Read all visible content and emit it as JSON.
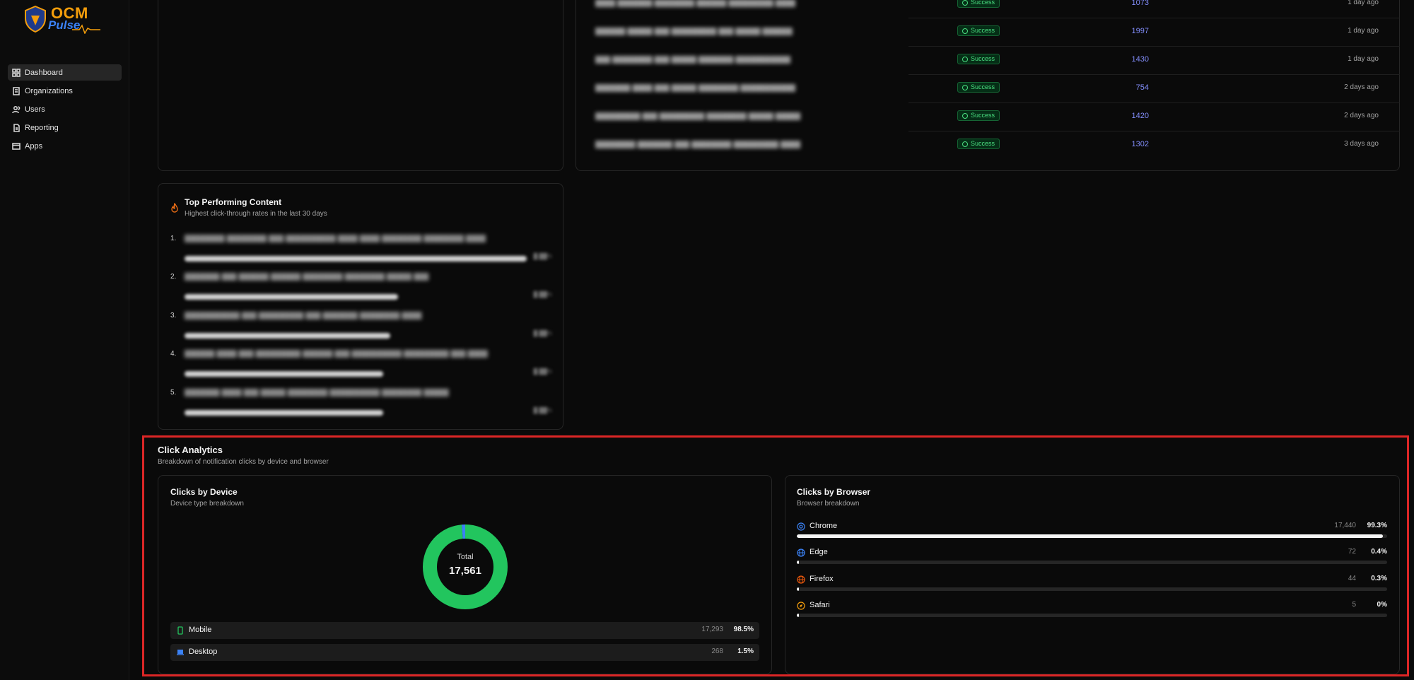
{
  "sidebar": {
    "logo": {
      "line1": "OCM",
      "line2": "Pulse"
    },
    "items": [
      {
        "label": "Dashboard",
        "icon": "grid-icon",
        "active": true
      },
      {
        "label": "Organizations",
        "icon": "building-icon",
        "active": false
      },
      {
        "label": "Users",
        "icon": "users-icon",
        "active": false
      },
      {
        "label": "Reporting",
        "icon": "file-icon",
        "active": false
      },
      {
        "label": "Apps",
        "icon": "window-icon",
        "active": false
      }
    ]
  },
  "recent": {
    "rows": [
      {
        "status": "Success",
        "count": "1073",
        "time": "1 day ago"
      },
      {
        "status": "Success",
        "count": "1997",
        "time": "1 day ago"
      },
      {
        "status": "Success",
        "count": "1430",
        "time": "1 day ago"
      },
      {
        "status": "Success",
        "count": "754",
        "time": "2 days ago"
      },
      {
        "status": "Success",
        "count": "1420",
        "time": "2 days ago"
      },
      {
        "status": "Success",
        "count": "1302",
        "time": "3 days ago"
      }
    ]
  },
  "top_content": {
    "title": "Top Performing Content",
    "subtitle": "Highest click-through rates in the last 30 days",
    "items": [
      {
        "rank": "1.",
        "fill": 0.93
      },
      {
        "rank": "2.",
        "fill": 0.58
      },
      {
        "rank": "3.",
        "fill": 0.56
      },
      {
        "rank": "4.",
        "fill": 0.54
      },
      {
        "rank": "5.",
        "fill": 0.54
      }
    ]
  },
  "click_analytics": {
    "title": "Click Analytics",
    "subtitle": "Breakdown of notification clicks by device and browser",
    "device": {
      "title": "Clicks by Device",
      "subtitle": "Device type breakdown",
      "total_label": "Total",
      "total": "17,561",
      "rows": [
        {
          "name": "Mobile",
          "count": "17,293",
          "pct": "98.5%",
          "icon": "phone-icon",
          "color": "#22c55e"
        },
        {
          "name": "Desktop",
          "count": "268",
          "pct": "1.5%",
          "icon": "laptop-icon",
          "color": "#3b82f6"
        }
      ]
    },
    "browser": {
      "title": "Clicks by Browser",
      "subtitle": "Browser breakdown",
      "rows": [
        {
          "name": "Chrome",
          "count": "17,440",
          "pct": "99.3%",
          "fill": 0.993,
          "icon": "chrome-icon",
          "color": "#3b82f6"
        },
        {
          "name": "Edge",
          "count": "72",
          "pct": "0.4%",
          "fill": 0.004,
          "icon": "globe-icon",
          "color": "#3b82f6"
        },
        {
          "name": "Firefox",
          "count": "44",
          "pct": "0.3%",
          "fill": 0.003,
          "icon": "globe-icon",
          "color": "#ea580c"
        },
        {
          "name": "Safari",
          "count": "5",
          "pct": "0%",
          "fill": 0.0,
          "icon": "compass-icon",
          "color": "#f59e0b"
        }
      ]
    }
  },
  "chart_data": {
    "type": "pie",
    "categories": [
      "Mobile",
      "Desktop"
    ],
    "values": [
      17293,
      268
    ],
    "colors": [
      "#22c55e",
      "#3b82f6"
    ]
  }
}
